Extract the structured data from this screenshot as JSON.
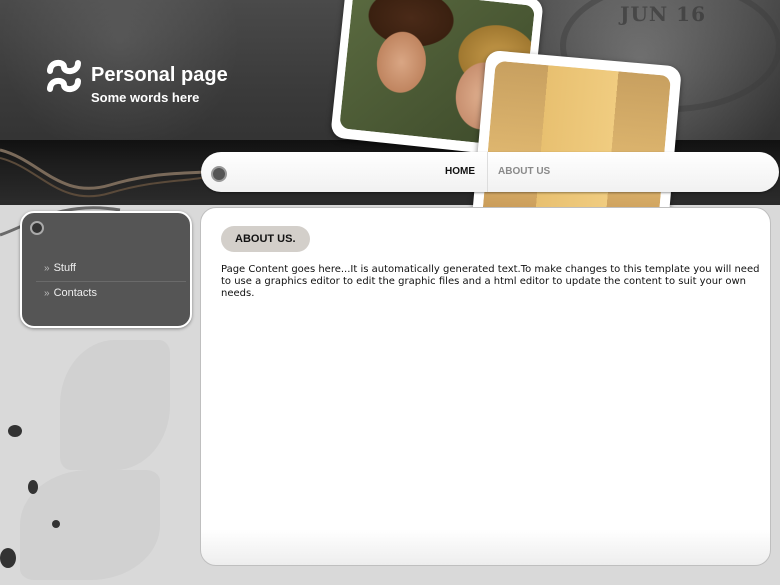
{
  "header": {
    "title": "Personal page",
    "subtitle": "Some words here",
    "stamp_text": "JUN 16"
  },
  "nav": {
    "items": [
      {
        "label": "HOME",
        "active": true
      },
      {
        "label": "ABOUT US",
        "active": false
      }
    ]
  },
  "sidebar": {
    "items": [
      {
        "label": "Stuff"
      },
      {
        "label": "Contacts"
      }
    ]
  },
  "main": {
    "heading": "ABOUT US.",
    "body": "Page Content goes here...It is automatically generated text.To make changes to this template you will need to use a graphics editor to edit the graphic files and a html editor to update the content to suit your own needs."
  },
  "colors": {
    "header_dark": "#2b2b2b",
    "sidebar_bg": "#555555",
    "tab_bg": "#d3cfca",
    "nav_inactive": "#8a8a8a"
  }
}
